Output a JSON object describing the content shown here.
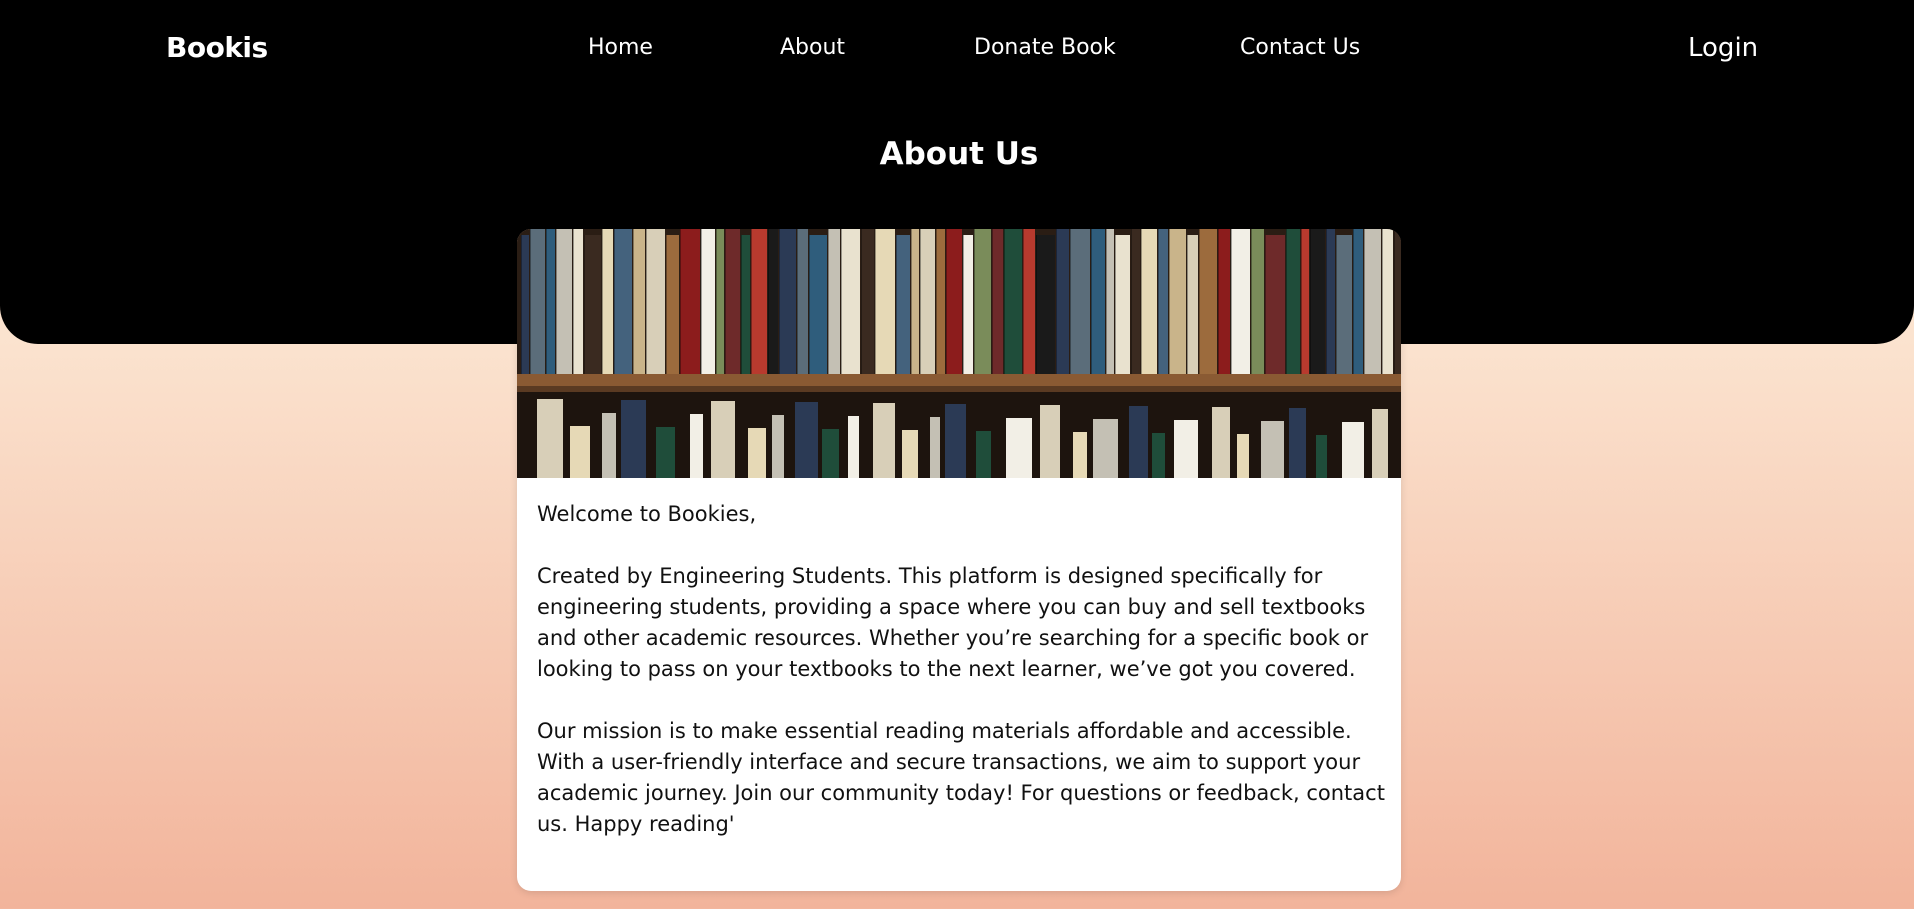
{
  "header": {
    "brand": "Bookis",
    "nav": [
      {
        "label": "Home"
      },
      {
        "label": "About"
      },
      {
        "label": "Donate Book"
      },
      {
        "label": "Contact Us"
      }
    ],
    "login_label": "Login"
  },
  "page": {
    "title": "About Us"
  },
  "about_card": {
    "image_icon": "bookshelf-photo",
    "paragraphs": [
      "Welcome to Bookies,",
      "Created by Engineering Students. This platform is designed specifically for engineering students, providing a space where you can buy and sell textbooks and other academic resources. Whether you’re searching for a specific book or looking to pass on your textbooks to the next learner, we’ve got you covered.",
      "Our mission is to make essential reading materials affordable and accessible. With a user-friendly interface and secure transactions, we aim to support your academic journey. Join our community today! For questions or feedback, contact us. Happy reading'"
    ]
  },
  "colors": {
    "header_bg": "#000000",
    "page_gradient_top": "#fbe3cf",
    "page_gradient_bottom": "#f2b49b",
    "card_bg": "#ffffff"
  }
}
